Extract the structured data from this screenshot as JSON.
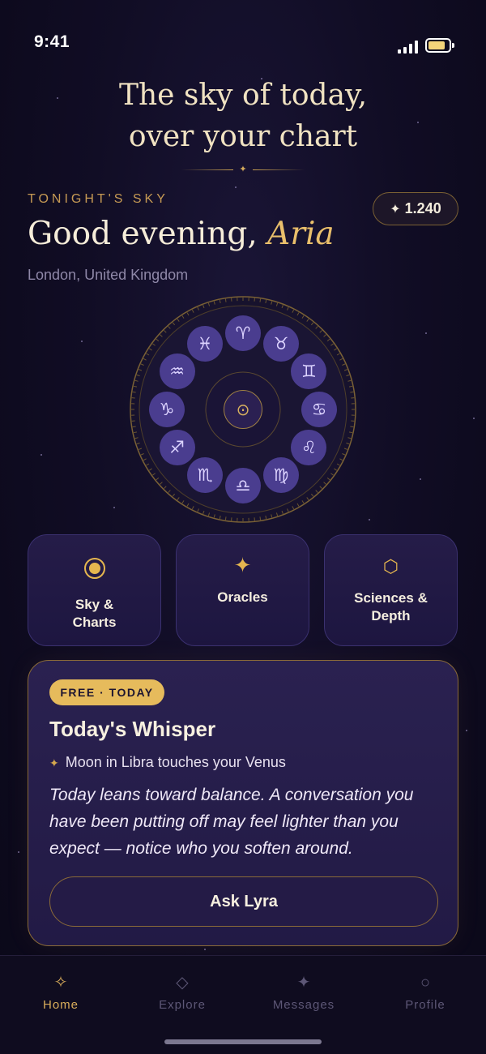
{
  "status": {
    "time": "9:41"
  },
  "header": {
    "line1": "The sky of today,",
    "line2": "over your chart"
  },
  "greeting": {
    "eyebrow": "TONIGHT'S SKY",
    "salutation": "Good evening,",
    "name": "Aria",
    "location": "London, United Kingdom",
    "credits": "1.240"
  },
  "wheel": {
    "signs": [
      {
        "name": "aries",
        "glyph": "♈"
      },
      {
        "name": "taurus",
        "glyph": "♉"
      },
      {
        "name": "gemini",
        "glyph": "♊"
      },
      {
        "name": "cancer",
        "glyph": "♋"
      },
      {
        "name": "leo",
        "glyph": "♌"
      },
      {
        "name": "virgo",
        "glyph": "♍"
      },
      {
        "name": "libra",
        "glyph": "♎"
      },
      {
        "name": "scorpio",
        "glyph": "♏"
      },
      {
        "name": "sagittarius",
        "glyph": "♐"
      },
      {
        "name": "capricorn",
        "glyph": "♑"
      },
      {
        "name": "aquarius",
        "glyph": "♒"
      },
      {
        "name": "pisces",
        "glyph": "♓"
      }
    ],
    "center_glyph": "⊙"
  },
  "tiles": [
    {
      "icon": "sun-icon",
      "line1": "Sky &",
      "line2": "Charts"
    },
    {
      "icon": "sparkle-icon",
      "line1": "Oracles",
      "line2": ""
    },
    {
      "icon": "hexagon-icon",
      "line1": "Sciences &",
      "line2": "Depth"
    }
  ],
  "whisper": {
    "badge": "FREE · TODAY",
    "title": "Today's Whisper",
    "transit": "Moon in Libra touches your Venus",
    "body": "Today leans toward balance. A conversation you have been putting off may feel lighter than you expect — notice who you soften around.",
    "button": "Ask Lyra"
  },
  "tabs": [
    {
      "label": "Home",
      "icon": "sparkle-outline-icon",
      "active": true
    },
    {
      "label": "Explore",
      "icon": "diamond-icon",
      "active": false
    },
    {
      "label": "Messages",
      "icon": "star-icon",
      "active": false
    },
    {
      "label": "Profile",
      "icon": "circle-icon",
      "active": false
    }
  ],
  "colors": {
    "background": "#0d0a1e",
    "gold": "#e6bb5c",
    "sign_fill": "#4a3d8f",
    "card": "#2a2150"
  }
}
